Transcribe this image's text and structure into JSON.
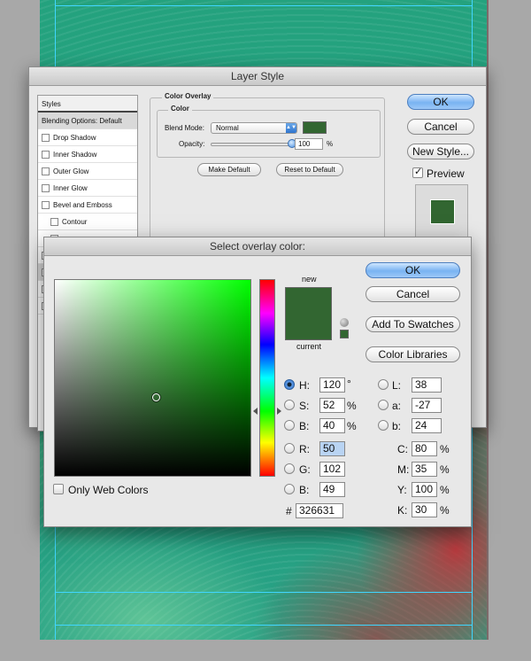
{
  "layer_style": {
    "title": "Layer Style",
    "styles_header": "Styles",
    "styles_items": [
      {
        "label": "Blending Options: Default"
      },
      {
        "label": "Drop Shadow"
      },
      {
        "label": "Inner Shadow"
      },
      {
        "label": "Outer Glow"
      },
      {
        "label": "Inner Glow"
      },
      {
        "label": "Bevel and Emboss"
      },
      {
        "label": "Contour"
      }
    ],
    "section_title": "Color Overlay",
    "group_title": "Color",
    "blend_mode_label": "Blend Mode:",
    "blend_mode_value": "Normal",
    "opacity_label": "Opacity:",
    "opacity_value": "100",
    "opacity_unit": "%",
    "opacity_level": 1.0,
    "make_default_label": "Make Default",
    "reset_default_label": "Reset to Default",
    "ok_label": "OK",
    "cancel_label": "Cancel",
    "new_style_label": "New Style...",
    "preview_label": "Preview",
    "preview_checked": true,
    "overlay_color": "#326631"
  },
  "color_picker": {
    "title": "Select overlay color:",
    "new_label": "new",
    "current_label": "current",
    "new_color": "#326631",
    "current_color": "#326631",
    "ok_label": "OK",
    "cancel_label": "Cancel",
    "add_swatches_label": "Add To Swatches",
    "color_libraries_label": "Color Libraries",
    "only_web_colors_label": "Only Web Colors",
    "hsb": [
      {
        "label": "H:",
        "value": "120",
        "unit": "°",
        "selected": true
      },
      {
        "label": "S:",
        "value": "52",
        "unit": "%"
      },
      {
        "label": "B:",
        "value": "40",
        "unit": "%"
      }
    ],
    "rgb": [
      {
        "label": "R:",
        "value": "50"
      },
      {
        "label": "G:",
        "value": "102"
      },
      {
        "label": "B:",
        "value": "49"
      }
    ],
    "lab": [
      {
        "label": "L:",
        "value": "38"
      },
      {
        "label": "a:",
        "value": "-27"
      },
      {
        "label": "b:",
        "value": "24"
      }
    ],
    "cmyk": [
      {
        "label": "C:",
        "value": "80",
        "unit": "%"
      },
      {
        "label": "M:",
        "value": "35",
        "unit": "%"
      },
      {
        "label": "Y:",
        "value": "100",
        "unit": "%"
      },
      {
        "label": "K:",
        "value": "30",
        "unit": "%"
      }
    ],
    "hex_label": "#",
    "hex_value": "326631",
    "field_hue_color": "#00ff00"
  }
}
